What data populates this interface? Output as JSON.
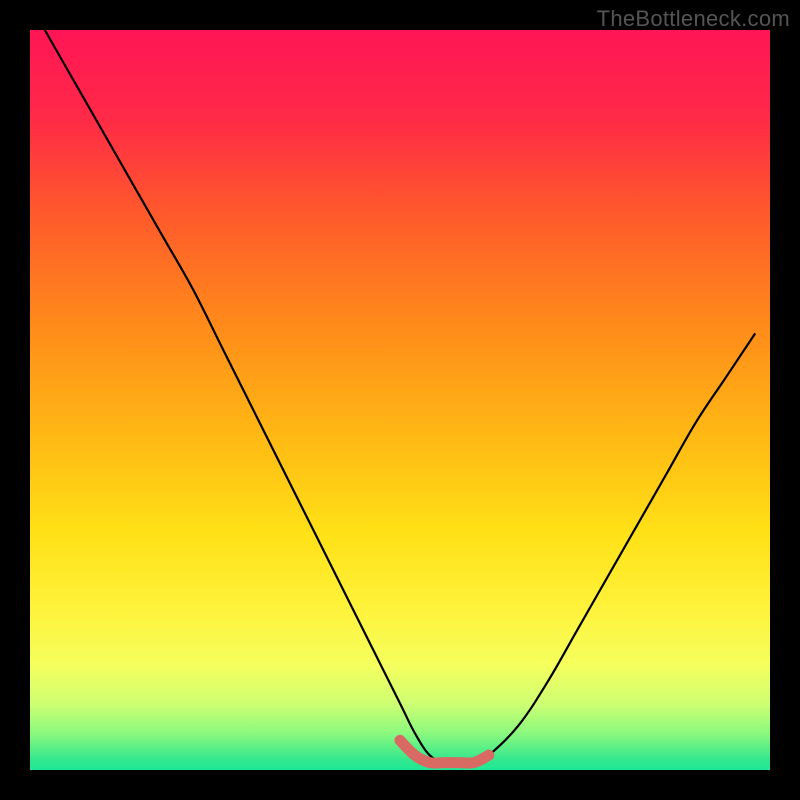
{
  "watermark": "TheBottleneck.com",
  "chart_data": {
    "type": "line",
    "title": "",
    "xlabel": "",
    "ylabel": "",
    "xlim": [
      0,
      100
    ],
    "ylim": [
      0,
      100
    ],
    "series": [
      {
        "name": "main-curve",
        "x": [
          2,
          6,
          10,
          14,
          18,
          22,
          26,
          30,
          34,
          38,
          42,
          46,
          50,
          52,
          54,
          56,
          58,
          60,
          62,
          66,
          70,
          74,
          78,
          82,
          86,
          90,
          94,
          98
        ],
        "y": [
          100,
          93,
          86,
          79,
          72,
          65,
          57,
          49,
          41,
          33,
          25,
          17,
          9,
          5,
          2,
          1,
          1,
          1,
          2,
          6,
          12,
          19,
          26,
          33,
          40,
          47,
          53,
          59
        ]
      },
      {
        "name": "highlight-bottom",
        "x": [
          50,
          52,
          54,
          56,
          58,
          60,
          62
        ],
        "y": [
          4,
          2,
          1,
          1,
          1,
          1,
          2
        ]
      }
    ],
    "gradient_stops": [
      {
        "offset": 0.0,
        "color": "#ff1556"
      },
      {
        "offset": 0.12,
        "color": "#ff2a47"
      },
      {
        "offset": 0.25,
        "color": "#ff5a2b"
      },
      {
        "offset": 0.4,
        "color": "#ff8b1a"
      },
      {
        "offset": 0.55,
        "color": "#ffb914"
      },
      {
        "offset": 0.68,
        "color": "#ffe116"
      },
      {
        "offset": 0.78,
        "color": "#fff23a"
      },
      {
        "offset": 0.86,
        "color": "#f4ff5e"
      },
      {
        "offset": 0.91,
        "color": "#ceff72"
      },
      {
        "offset": 0.95,
        "color": "#8cf97e"
      },
      {
        "offset": 0.985,
        "color": "#36e88c"
      },
      {
        "offset": 1.0,
        "color": "#1de896"
      }
    ],
    "colors": {
      "curve": "#000000",
      "highlight": "#d86a63",
      "frame": "#000000"
    }
  }
}
